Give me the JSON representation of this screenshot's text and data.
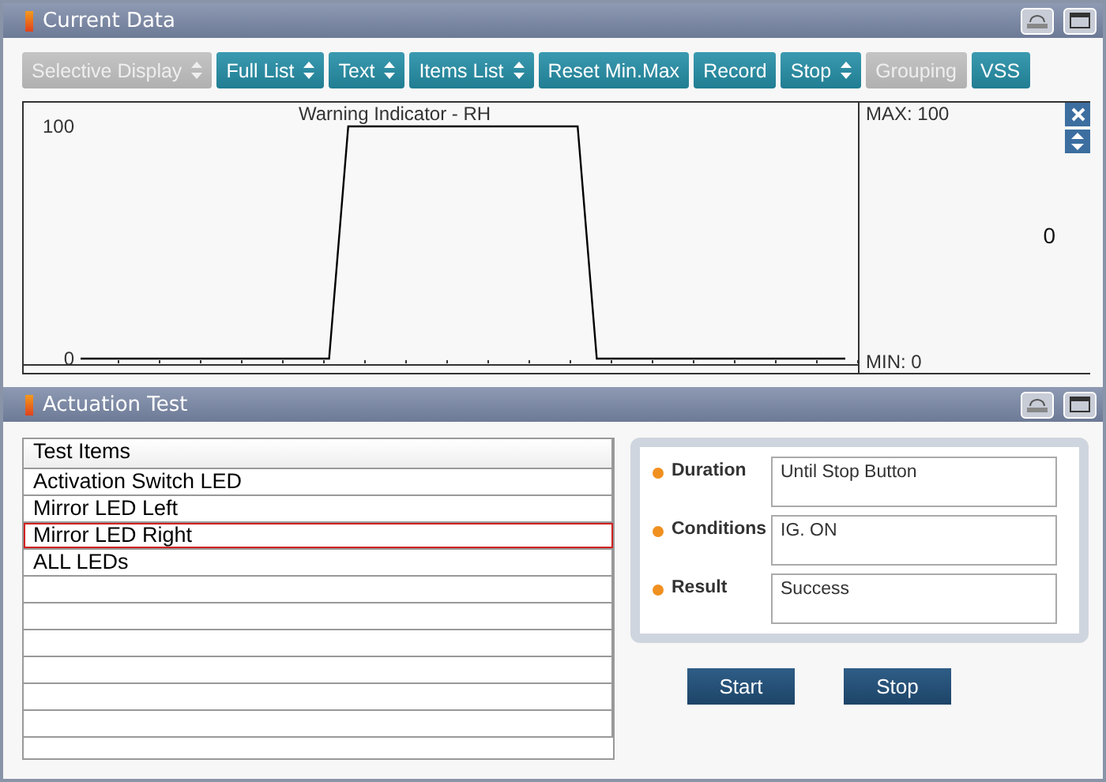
{
  "current_data": {
    "title": "Current Data",
    "toolbar": [
      {
        "label": "Selective Display",
        "kind": "dropdown",
        "disabled": true
      },
      {
        "label": "Full List",
        "kind": "dropdown",
        "disabled": false
      },
      {
        "label": "Text",
        "kind": "dropdown",
        "disabled": false
      },
      {
        "label": "Items List",
        "kind": "dropdown",
        "disabled": false
      },
      {
        "label": "Reset Min.Max",
        "kind": "plain",
        "disabled": false
      },
      {
        "label": "Record",
        "kind": "plain",
        "disabled": false
      },
      {
        "label": "Stop",
        "kind": "dropdown",
        "disabled": false
      },
      {
        "label": "Grouping",
        "kind": "plain",
        "disabled": true
      },
      {
        "label": "VSS",
        "kind": "plain",
        "disabled": false
      }
    ],
    "graph": {
      "max": "MAX: 100",
      "min": "MIN: 0",
      "current": "0",
      "chart_data": {
        "type": "line",
        "title": "Warning Indicator - RH",
        "ylim": [
          0,
          100
        ],
        "yticks": [
          0,
          100
        ],
        "series": [
          {
            "color": "#000000",
            "values": [
              0,
              0,
              0,
              0,
              0,
              0,
              0,
              0,
              0,
              0,
              0,
              0,
              0,
              0,
              100,
              100,
              100,
              100,
              100,
              100,
              100,
              100,
              100,
              100,
              100,
              100,
              100,
              0,
              0,
              0,
              0,
              0,
              0,
              0,
              0,
              0,
              0,
              0,
              0,
              0,
              0
            ]
          }
        ]
      }
    }
  },
  "actuation_test": {
    "title": "Actuation Test",
    "list": {
      "header": "Test Items",
      "rows": [
        {
          "label": "Activation Switch LED",
          "selected": false
        },
        {
          "label": "Mirror LED Left",
          "selected": false
        },
        {
          "label": "Mirror LED Right",
          "selected": true
        },
        {
          "label": "ALL LEDs",
          "selected": false
        }
      ]
    },
    "info": [
      {
        "label": "Duration",
        "value": "Until Stop Button"
      },
      {
        "label": "Conditions",
        "value": "IG. ON"
      },
      {
        "label": "Result",
        "value": "Success"
      }
    ],
    "buttons": [
      "Start",
      "Stop"
    ]
  }
}
